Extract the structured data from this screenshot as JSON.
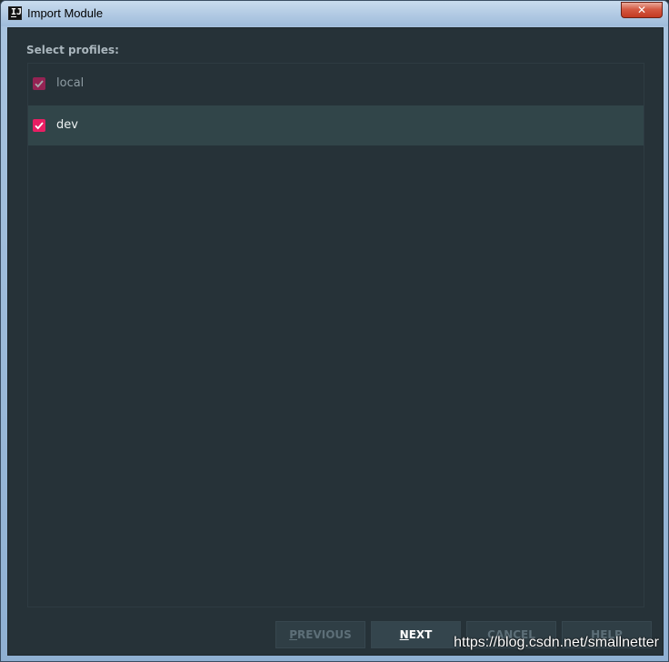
{
  "window": {
    "title": "Import Module",
    "close_label": "✕"
  },
  "section_label": "Select profiles:",
  "profiles": [
    {
      "label": "local",
      "checked": true,
      "selected": false
    },
    {
      "label": "dev",
      "checked": true,
      "selected": true
    }
  ],
  "buttons": {
    "previous": {
      "mnemonic": "P",
      "rest": "REVIOUS"
    },
    "next": {
      "mnemonic": "N",
      "rest": "EXT"
    },
    "cancel": "CANCEL",
    "help": "HELP"
  },
  "watermark": "https://blog.csdn.net/smallnetter",
  "colors": {
    "background": "#263238",
    "selected_row": "#314549",
    "checkbox_accent": "#e91e63",
    "button_bg": "#2f3e45"
  }
}
